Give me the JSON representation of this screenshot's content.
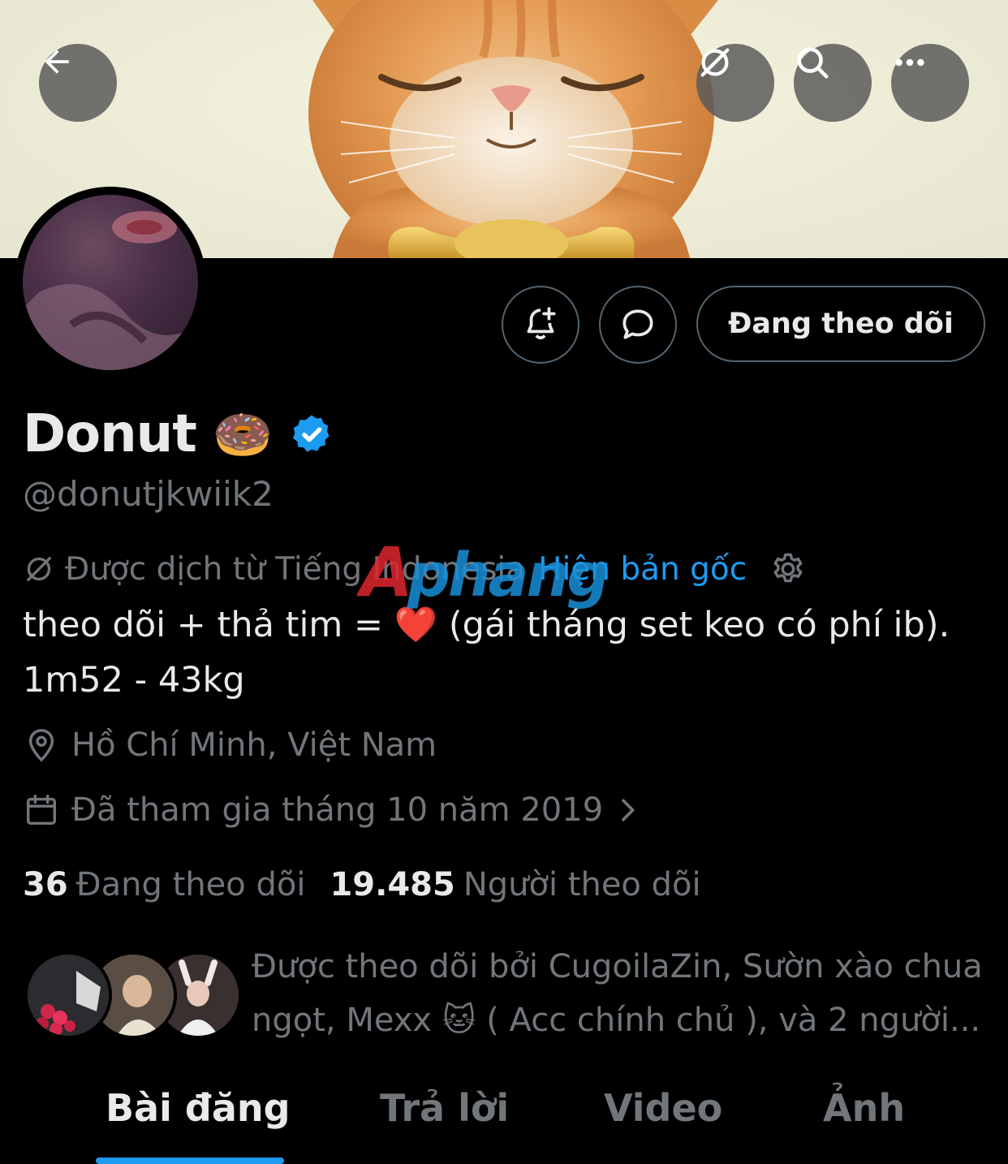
{
  "header": {
    "back_icon": "arrow-left-icon",
    "actions": [
      "translate-off-icon",
      "search-icon",
      "more-icon"
    ]
  },
  "profile": {
    "display_name": "Donut",
    "name_emoji": "🍩",
    "verified": true,
    "handle": "@donutjkwiik2",
    "follow_button": "Đang theo dõi",
    "translation": {
      "label": "Được dịch từ Tiếng Indonesia",
      "show_original": "Hiện bản gốc"
    },
    "bio_line1_a": "theo dõi + thả tim = ",
    "bio_line1_emoji": "❤️",
    "bio_line1_b": " (gái tháng set keo có phí ib).",
    "bio_line2": "1m52 - 43kg",
    "location": "Hồ Chí Minh, Việt Nam",
    "joined": "Đã tham gia tháng 10 năm 2019",
    "following_count": "36",
    "following_label": "Đang theo dõi",
    "followers_count": "19.485",
    "followers_label": "Người theo dõi",
    "followed_by_a": "Được theo dõi bởi CugoilaZin, Sườn xào chua",
    "followed_by_b": "ngọt, Mexx ",
    "followed_by_emoji": "🐱",
    "followed_by_c": " ( Acc chính chủ ), và 2 người..."
  },
  "tabs": [
    {
      "label": "Bài đăng",
      "active": true
    },
    {
      "label": "Trả lời",
      "active": false
    },
    {
      "label": "Video",
      "active": false
    },
    {
      "label": "Ảnh",
      "active": false
    }
  ],
  "watermark": "Aphang",
  "colors": {
    "background": "#000000",
    "accent": "#1d9bf0",
    "text_primary": "#e7e9ea",
    "text_secondary": "#71767b",
    "border": "#536471"
  }
}
